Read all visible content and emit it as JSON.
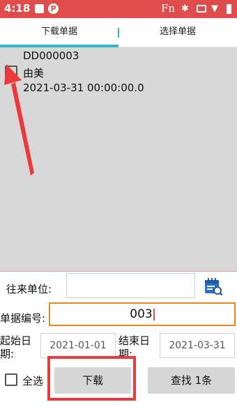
{
  "status_bar": {
    "time": "4:18",
    "p_badge": "P",
    "fn_label": "Fn",
    "icons": [
      "square-icon",
      "p-badge-icon",
      "fn-icon",
      "bluetooth-icon",
      "cast-icon",
      "wifi-icon",
      "battery-icon"
    ],
    "background_color": "#e04b4b"
  },
  "tabs": [
    {
      "label": "下载单据",
      "active": true
    },
    {
      "label": "选择单据",
      "active": false
    }
  ],
  "accent_color": "#39b4c9",
  "list": {
    "items": [
      {
        "code": "DD000003",
        "name": "由美",
        "date": "2021-03-31 00:00:00.0",
        "checked": false
      }
    ]
  },
  "form": {
    "partner_label": "往来单位:",
    "partner_value": "",
    "calendar_icon": "calendar-search-icon",
    "bill_no_label": "单据编号:",
    "bill_no_value": "003",
    "start_date_label": "起始日期:",
    "start_date_value": "2021-01-01",
    "end_date_label": "结束日期:",
    "end_date_value": "2021-03-31",
    "select_all_label": "全选",
    "select_all_checked": false,
    "download_button": "下载",
    "search_button": "查找 1条"
  },
  "annotation_color": "#ea3a3a"
}
